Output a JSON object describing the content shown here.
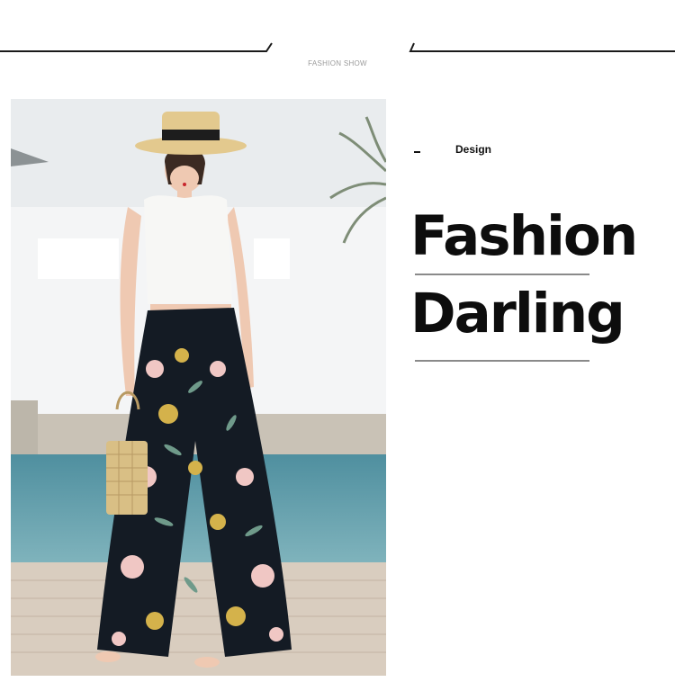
{
  "header": {
    "label": "FASHION SHOW"
  },
  "photo": {
    "description_label": ""
  },
  "side": {
    "section_label": "Design",
    "title_line1": "Fashion",
    "title_line2": "Darling"
  },
  "colors": {
    "text": "#0d0d0d",
    "divider": "#8a8a8a",
    "rule": "#1a1a1a"
  }
}
